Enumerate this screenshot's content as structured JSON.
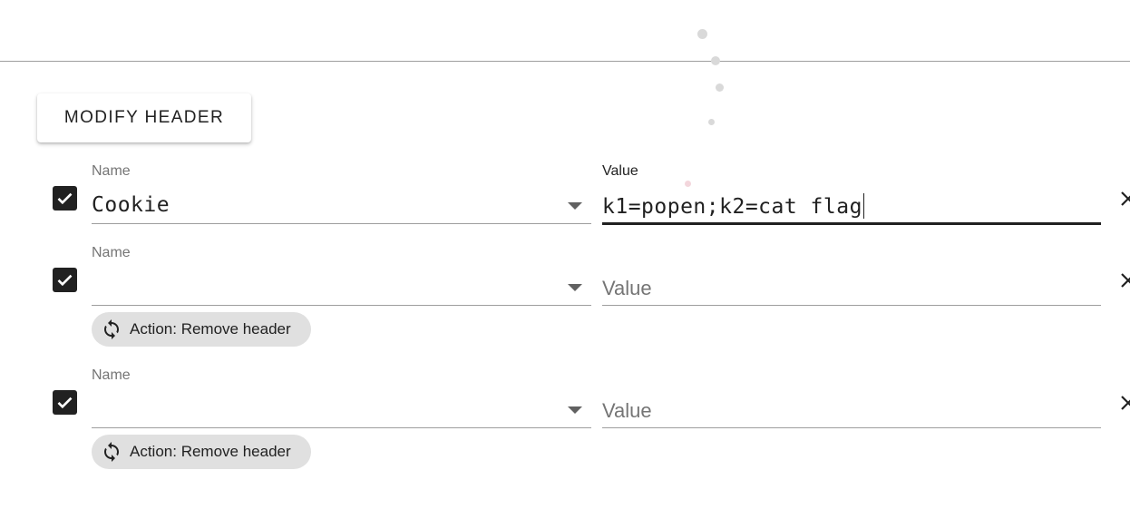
{
  "toolbar": {
    "modify_header_label": "MODIFY HEADER"
  },
  "headers": [
    {
      "enabled": true,
      "name_label": "Name",
      "name_value": "Cookie",
      "value_label": "Value",
      "value_value": "k1=popen;k2=cat flag",
      "value_placeholder": ""
    },
    {
      "enabled": true,
      "name_label": "Name",
      "name_value": "",
      "value_label": "",
      "value_value": "",
      "value_placeholder": "Value",
      "action_chip": "Action: Remove header"
    },
    {
      "enabled": true,
      "name_label": "Name",
      "name_value": "",
      "value_label": "",
      "value_value": "",
      "value_placeholder": "Value",
      "action_chip": "Action: Remove header"
    }
  ],
  "icons": {
    "checkbox": "check-icon",
    "dropdown": "caret-down-icon",
    "remove": "close-icon",
    "chip": "sync-icon"
  },
  "colors": {
    "text": "#212121",
    "label": "#757575",
    "chip_bg": "#e0e0e0",
    "divider": "#9e9e9e"
  }
}
